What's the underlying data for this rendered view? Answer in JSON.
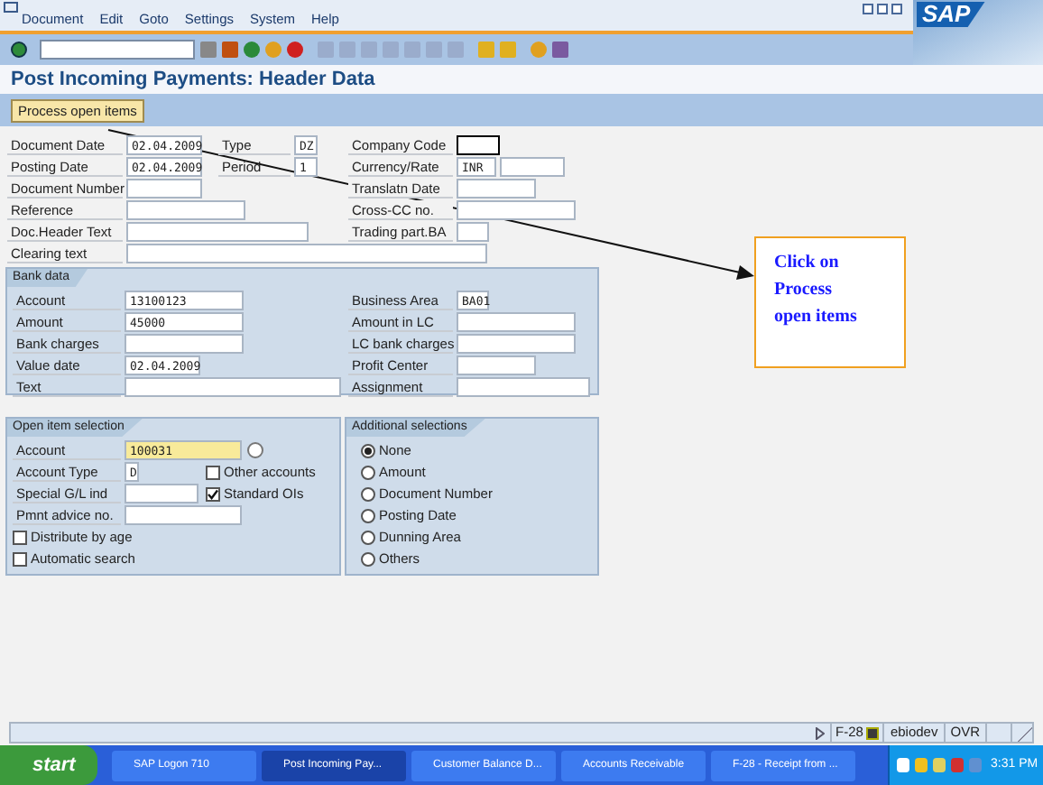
{
  "menu": [
    {
      "label": "Document"
    },
    {
      "label": "Edit"
    },
    {
      "label": "Goto"
    },
    {
      "label": "Settings"
    },
    {
      "label": "System"
    },
    {
      "label": "Help"
    }
  ],
  "logo": "SAP",
  "title": "Post Incoming Payments: Header Data",
  "action_button": "Process open items",
  "header_rows": [
    {
      "left": {
        "label": "Document Date",
        "value": "02.04.2009"
      },
      "middle": {
        "label": "Type",
        "value": "DZ"
      },
      "right": {
        "label": "Company Code"
      }
    },
    {
      "left": {
        "label": "Posting Date",
        "value": "02.04.2009"
      },
      "middle": {
        "label": "Period",
        "value": "1"
      },
      "right": {
        "label": "Currency/Rate",
        "value": "INR",
        "extra_field": true
      }
    },
    {
      "left": {
        "label": "Document Number"
      },
      "right": {
        "label": "Translatn Date"
      }
    },
    {
      "left": {
        "label": "Reference"
      },
      "right": {
        "label": "Cross-CC no."
      }
    },
    {
      "left": {
        "label": "Doc.Header Text"
      },
      "right": {
        "label": "Trading part.BA"
      }
    },
    {
      "left": {
        "label": "Clearing text"
      }
    }
  ],
  "bank_data": {
    "title": "Bank data",
    "rows": [
      {
        "left": {
          "label": "Account",
          "value": "13100123"
        },
        "right": {
          "label": "Business Area",
          "value": "BA01"
        }
      },
      {
        "left": {
          "label": "Amount",
          "value": "45000"
        },
        "right": {
          "label": "Amount in LC"
        }
      },
      {
        "left": {
          "label": "Bank charges"
        },
        "right": {
          "label": "LC bank charges"
        }
      },
      {
        "left": {
          "label": "Value date",
          "value": "02.04.2009"
        },
        "right": {
          "label": "Profit Center"
        }
      },
      {
        "left": {
          "label": "Text"
        },
        "right": {
          "label": "Assignment"
        }
      }
    ]
  },
  "open_item_selection": {
    "title": "Open item selection",
    "account": {
      "label": "Account",
      "value": "100031"
    },
    "account_type": {
      "label": "Account Type",
      "value": "D"
    },
    "other_accounts": {
      "label": "Other accounts",
      "checked": false
    },
    "special_gl": {
      "label": "Special G/L ind"
    },
    "standard_ois": {
      "label": "Standard OIs",
      "checked": true
    },
    "pmnt_advice": {
      "label": "Pmnt advice no."
    },
    "checkboxes": [
      {
        "label": "Distribute by age",
        "checked": false
      },
      {
        "label": "Automatic search",
        "checked": false
      }
    ]
  },
  "additional_selections": {
    "title": "Additional selections",
    "options": [
      {
        "label": "None",
        "selected": true
      },
      {
        "label": "Amount",
        "selected": false
      },
      {
        "label": "Document Number",
        "selected": false
      },
      {
        "label": "Posting Date",
        "selected": false
      },
      {
        "label": "Dunning Area",
        "selected": false
      },
      {
        "label": "Others",
        "selected": false
      }
    ]
  },
  "callout": "Click on Process open items",
  "status_bar": {
    "transaction": "F-28",
    "system": "ebiodev",
    "mode": "OVR"
  },
  "taskbar": {
    "start": "start",
    "items": [
      {
        "label": "SAP Logon 710",
        "selected": false
      },
      {
        "label": "Post Incoming Pay...",
        "selected": true
      },
      {
        "label": "Customer Balance D...",
        "selected": false
      },
      {
        "label": "Accounts Receivable",
        "selected": false
      },
      {
        "label": "F-28 - Receipt from ...",
        "selected": false
      }
    ],
    "time": "3:31 PM"
  }
}
